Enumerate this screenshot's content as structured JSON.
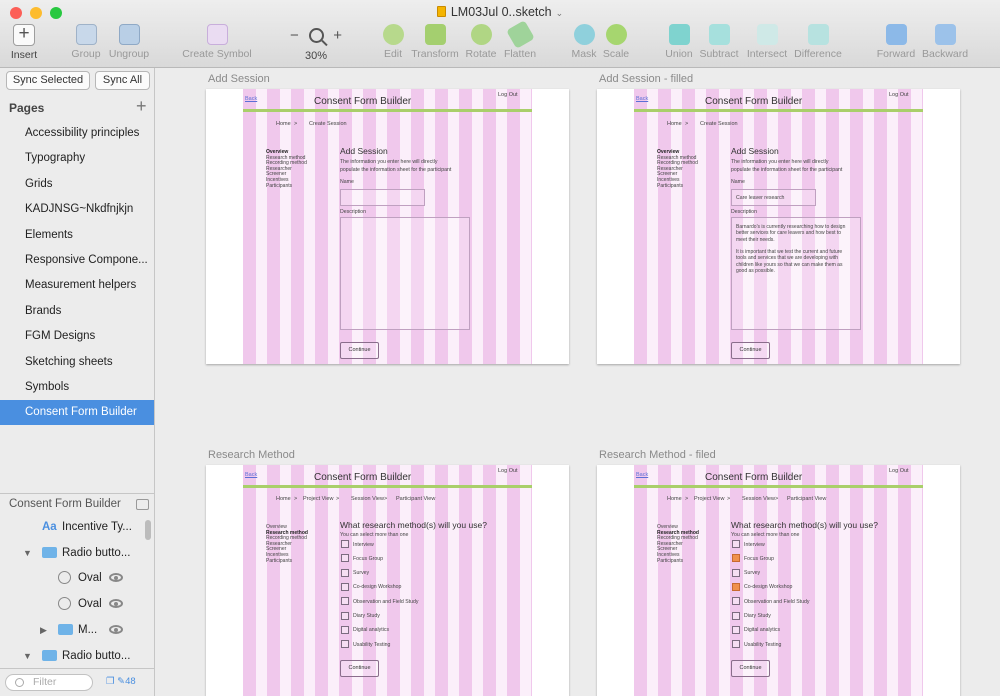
{
  "window": {
    "title": "LM03Jul 0..sketch",
    "lights": [
      "#fc5f57",
      "#fdbc2e",
      "#28c840"
    ]
  },
  "toolbar": {
    "insert": "Insert",
    "group": "Group",
    "ungroup": "Ungroup",
    "create_symbol": "Create Symbol",
    "zoom_minus": "−",
    "zoom_plus": "+",
    "zoom_level": "30%",
    "edit": "Edit",
    "transform": "Transform",
    "rotate": "Rotate",
    "flatten": "Flatten",
    "mask": "Mask",
    "scale": "Scale",
    "union": "Union",
    "subtract": "Subtract",
    "intersect": "Intersect",
    "difference": "Difference",
    "forward": "Forward",
    "backward": "Backward"
  },
  "sidebar": {
    "sync_selected": "Sync Selected",
    "sync_all": "Sync All",
    "pages_header": "Pages",
    "add_page": "+",
    "pages": [
      "Accessibility principles",
      "Typography",
      "Grids",
      "KADJNSG~Nkdfnjkjn",
      "Elements",
      "Responsive Compone...",
      "Measurement helpers",
      "Brands",
      "FGM Designs",
      "Sketching sheets",
      "Symbols",
      "Consent Form Builder"
    ],
    "selected_page": "Consent Form Builder",
    "layers_header": "Consent Form Builder",
    "layers": [
      {
        "label": "Incentive Ty...",
        "icon": "text-icon",
        "glyph": "Aa"
      },
      {
        "label": "Radio butto...",
        "icon": "folder-icon"
      },
      {
        "label": "Oval",
        "icon": "oval-icon"
      },
      {
        "label": "Oval",
        "icon": "oval-icon"
      },
      {
        "label": "M...",
        "icon": "folder-icon"
      },
      {
        "label": "Radio butto...",
        "icon": "folder-icon"
      }
    ],
    "filter_placeholder": "Filter",
    "symbol_count": "48"
  },
  "artboards": [
    {
      "title": "Add Session",
      "header": "Consent Form Builder",
      "back": "Back",
      "logout": "Log Out",
      "crumb_home": "Home",
      "crumb_sep": ">",
      "crumb_current": "Create Session",
      "nav": [
        "Overview",
        "Research method",
        "Recording method",
        "Researcher",
        "Screener",
        "Incentives",
        "Participants"
      ],
      "heading": "Add Session",
      "intro1": "The information you enter here will directly",
      "intro2": "populate the information sheet for the participant",
      "name_label": "Name",
      "name_value": "",
      "desc_label": "Description",
      "desc_p1": [],
      "desc_p2": [],
      "button": "Continue"
    },
    {
      "title": "Add Session - filled",
      "header": "Consent Form Builder",
      "back": "Back",
      "logout": "Log Out",
      "crumb_home": "Home",
      "crumb_sep": ">",
      "crumb_current": "Create Session",
      "nav": [
        "Overview",
        "Research method",
        "Recording method",
        "Researcher",
        "Screener",
        "Incentives",
        "Participants"
      ],
      "heading": "Add Session",
      "intro1": "The information you enter here will directly",
      "intro2": "populate the information sheet for the participant",
      "name_label": "Name",
      "name_value": "Care leaver research",
      "desc_label": "Description",
      "desc_p1": [
        "Barnardo's is currently researching how to design",
        "better services for care leavers and how best to",
        "meet their needs."
      ],
      "desc_p2": [
        "It is important that we test the current and future",
        "tools and services that we are developing with",
        "children like yours so that we can make them as",
        "good as possible."
      ],
      "button": "Continue"
    },
    {
      "title": "Research Method",
      "header": "Consent Form Builder",
      "back": "Back",
      "logout": "Log Out",
      "crumbs": [
        "Home",
        ">",
        "Project View",
        ">",
        "Session View",
        ">",
        "Participant View"
      ],
      "nav": [
        "Overview",
        "Research method",
        "Recording method",
        "Researcher",
        "Screener",
        "Incentives",
        "Participants"
      ],
      "question": "What research method(s) will you use?",
      "hint": "You can select more than one",
      "options": [
        "Interview",
        "Focus Group",
        "Survey",
        "Co-design Workshop",
        "Observation and Field Study",
        "Diary Study",
        "Digital analytics",
        "Usability Testing"
      ],
      "checked": [
        false,
        false,
        false,
        false,
        false,
        false,
        false,
        false
      ],
      "button": "Continue"
    },
    {
      "title": "Research Method - filed",
      "header": "Consent Form Builder",
      "back": "Back",
      "logout": "Log Out",
      "crumbs": [
        "Home",
        ">",
        "Project View",
        ">",
        "Session View",
        ">",
        "Participant View"
      ],
      "nav": [
        "Overview",
        "Research method",
        "Recording method",
        "Researcher",
        "Screener",
        "Incentives",
        "Participants"
      ],
      "question": "What research method(s) will you use?",
      "hint": "You can select more than one",
      "options": [
        "Interview",
        "Focus Group",
        "Survey",
        "Co-design Workshop",
        "Observation and Field Study",
        "Diary Study",
        "Digital analytics",
        "Usability Testing"
      ],
      "checked": [
        false,
        true,
        false,
        true,
        false,
        false,
        false,
        false
      ],
      "button": "Continue"
    }
  ],
  "colors": {
    "accent": "#4a8fe0",
    "grid_pink": "#f0c8ec",
    "bar_green": "#a9cf6a",
    "checked_orange": "#f0904c"
  }
}
